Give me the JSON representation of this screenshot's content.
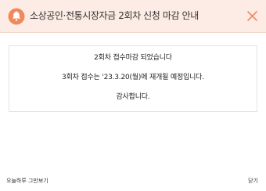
{
  "header": {
    "title": "소상공인·전통시장자금 2회차 신청 마감 안내",
    "bell_icon": "bell-icon",
    "close_icon": "close-icon",
    "accent_color": "#f08a5d",
    "background_color": "#fdece5"
  },
  "notice": {
    "line1": "2회차 접수마감 되었습니다",
    "line2": "3회차 접수는 '23.3.20(월)에 재개될 예정입니다.",
    "line3": "감사합니다."
  },
  "footer": {
    "hide_today_label": "오늘하루 그만보기",
    "close_label": "닫기"
  }
}
